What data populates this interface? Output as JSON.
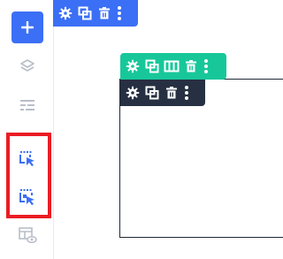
{
  "sidebar": {
    "buttons": [
      {
        "name": "add-icon"
      },
      {
        "name": "layers-icon"
      },
      {
        "name": "navigator-icon"
      },
      {
        "name": "select-parent-icon"
      },
      {
        "name": "select-child-icon"
      },
      {
        "name": "preview-layout-icon"
      }
    ]
  },
  "toolbars": {
    "outer": {
      "icons": [
        "gear-icon",
        "duplicate-icon",
        "trash-icon",
        "more-icon"
      ]
    },
    "container": {
      "icons": [
        "gear-icon",
        "duplicate-icon",
        "columns-icon",
        "trash-icon",
        "more-icon"
      ]
    },
    "inner": {
      "icons": [
        "gear-icon",
        "duplicate-icon",
        "trash-icon",
        "more-icon"
      ]
    }
  },
  "colors": {
    "primary": "#3b6ff5",
    "section": "#17c79a",
    "element": "#263042",
    "highlight": "#ea1c24"
  }
}
